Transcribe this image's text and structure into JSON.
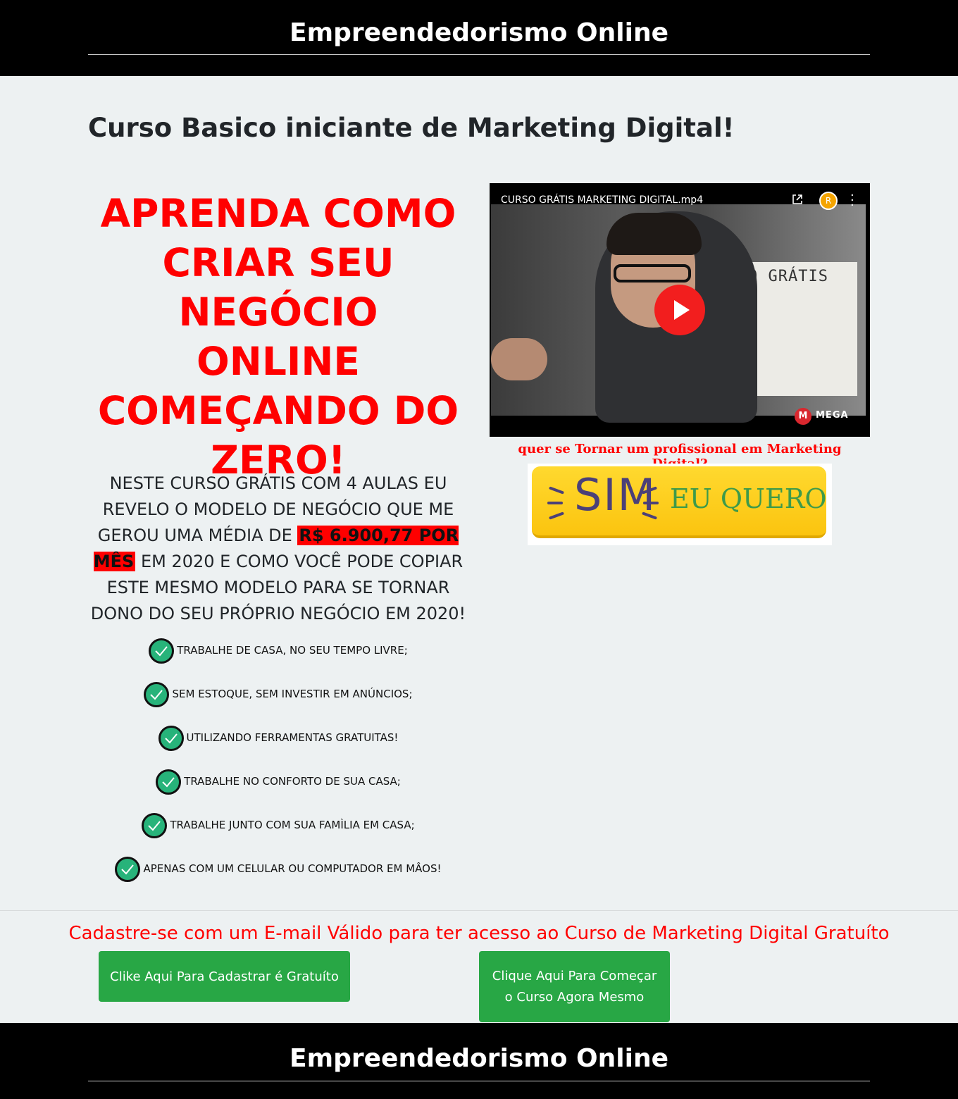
{
  "header": {
    "brand": "Empreendedorismo Online"
  },
  "page_title": "Curso Basico iniciante de Marketing Digital!",
  "headline": "APRENDA COMO CRIAR SEU NEGÓCIO ONLINE COMEÇANDO DO ZERO!",
  "intro": {
    "before": "NESTE CURSO GRÁTIS COM 4 AULAS EU REVELO O MODELO DE NEGÓCIO QUE ME GEROU UMA MÉDIA DE ",
    "highlight": "R$ 6.900,77 POR MÊS",
    "after": " EM 2020 E COMO VOCÊ PODE COPIAR ESTE MESMO MODELO PARA SE TORNAR DONO DO SEU PRÓPRIO NEGÓCIO EM 2020!"
  },
  "benefits": [
    "TRABALHE DE CASA, NO SEU TEMPO LIVRE;",
    "SEM ESTOQUE, SEM INVESTIR EM ANÚNCIOS;",
    "UTILIZANDO FERRAMENTAS GRATUITAS!",
    "TRABALHE NO CONFORTO DE SUA CASA;",
    "TRABALHE JUNTO COM SUA FAMÌLIA EM CASA;",
    "APENAS COM UM CELULAR OU COMPUTADOR EM MÂOS!"
  ],
  "video": {
    "title": "CURSO GRÁTIS MARKETING DIGITAL.mp4",
    "avatar_letter": "R",
    "board_text": "CURSO GRÁTIS",
    "provider": "MEGA",
    "provider_icon_letter": "M"
  },
  "question": "quer se Tornar um profissional em Marketing Digital?",
  "cta_image": {
    "word1": "SIM",
    "word2": "EU QUERO"
  },
  "register_text": "Cadastre-se com um E-mail Válido para ter acesso ao Curso de Marketing Digital Gratuíto",
  "buttons": {
    "register": "Clike Aqui Para Cadastrar é Gratuíto",
    "start": "Clique Aqui Para Começar o Curso Agora Mesmo"
  },
  "footer": {
    "brand": "Empreendedorismo Online"
  },
  "colors": {
    "accent_red": "#ff0000",
    "button_green": "#28a745",
    "check_green": "#27b37a"
  }
}
